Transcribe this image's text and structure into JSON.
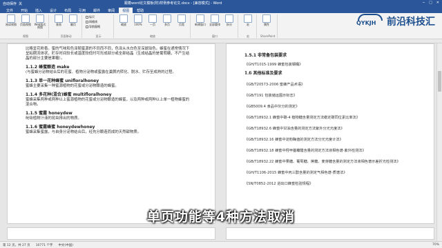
{
  "window": {
    "doc_title": "跟着word论文模板(附)样例参考论文.docx - [兼容模式] - Word",
    "quick_access": [
      "自动保存",
      "关"
    ]
  },
  "ribbon": {
    "tabs": [
      "文件",
      "开始",
      "插入",
      "设计",
      "布局",
      "引用",
      "邮件",
      "审阅",
      "视图",
      "帮助"
    ],
    "active_tab": "视图",
    "groups": [
      {
        "name": "视图",
        "buttons": [
          "阅读视图",
          "页面视图",
          "Web版式视图"
        ]
      },
      {
        "name": "页面移动",
        "buttons": [
          "垂直",
          "翻页"
        ]
      },
      {
        "name": "显示",
        "checks": [
          "标尺",
          "网格线",
          "导航窗格"
        ]
      },
      {
        "name": "缩放",
        "buttons": [
          "缩放",
          "100%",
          "一页",
          "多页",
          "页宽"
        ]
      },
      {
        "name": "窗口",
        "buttons": [
          "新建窗口",
          "全部重排",
          "拆分"
        ]
      },
      {
        "name": "宏",
        "buttons": [
          "宏"
        ]
      },
      {
        "name": "SharePoint",
        "buttons": [
          "属性"
        ]
      }
    ]
  },
  "logo": {
    "mark": "QYKJH",
    "name": "前沿科技汇"
  },
  "left_page": {
    "items": [
      {
        "type": "line",
        "text": "比略呈花粉香。蜜的气味和色泽随蜜源的不同而不同，色泽从水白色至深琥珀色。蜂蜜在通常情况下"
      },
      {
        "type": "line",
        "text": "呈粘稠流体状，贮存时间较长或温度较低时可形成部分或全部结晶（生成结晶的是葡萄糖，不产生结"
      },
      {
        "type": "line",
        "text": "晶的部分主要是果糖）。"
      },
      {
        "type": "hd",
        "text": "1.1.2 蜂蜜酿造 make"
      },
      {
        "type": "line",
        "text": "(与蜜蜂分泌物结合后的花蜜、植物分泌物或蜜露在巢脾内转化、脱水、贮存至成熟的过程。"
      },
      {
        "type": "hd",
        "text": "1.1.3 单一花种蜂蜜 unifloralhoney"
      },
      {
        "type": "line",
        "text": "蜜蜂主要采集一种蜜源植物的花蜜或分泌物酿造的蜂蜜。"
      },
      {
        "type": "hd",
        "text": "1.1.4 多花种(混合)蜂蜜 multifloralhoney"
      },
      {
        "type": "line",
        "text": "蜜蜂采集两种或两种以上蜜源植物的花蜜或分泌物酿造的蜂蜜，以及两种或两种以上单一植物蜂蜜的"
      },
      {
        "type": "line",
        "text": "混合物。"
      },
      {
        "type": "hd",
        "text": "1.1.5 蜜露 honeydew"
      },
      {
        "type": "line",
        "text": "吮吸植物汁液的昆虫排出的物质。"
      },
      {
        "type": "hd",
        "text": "1.1.6 蜜露蜂蜜 honeydewhoney"
      },
      {
        "type": "line",
        "text": "蜜蜂采集蜜露，与自身分泌物结合后，经充分酿造而成的天然甜物质。"
      }
    ]
  },
  "right_page": {
    "heading1": "1.5.1 非常备包装要求",
    "first_std": "《GH/T1015-1999 蜂蜜包装钢桶》",
    "heading2": "1.6 其他标准及要求",
    "standards": [
      "《GB/T20573-2006 蜜蜂产品术语》",
      "《GB/T191 包装储运图示标志》",
      "《GB5009.4 食品中灰分的测定》",
      "《GB/T18932.1 蜂蜜中碳-4 植物糖含量测定方法稳定碳同位素比率法》",
      "《GB/T18932.6 蜂蜜中甘油含量的测定方法紫外分光光度法》",
      "《GB/T18932.16 蜂蜜中淀粉酶值的测定方法分光光度计法》",
      "《GB/T18932.18 蜂蜜中羟甲基糠醛含量的测定方法液相色谱-紫外检测法》",
      "《GB/T18932.22 蜂蜜中果糖、葡萄糖、蔗糖、麦芽糖含量的测定方法液相色谱示差折光检测法》",
      "《GH/T1106-2015 蜂蜜中丙三醇含量的测定气相色谱-质谱法》",
      "《SN/T0852-2012 进出口蜂蜜检验规程》"
    ]
  },
  "status": {
    "page": "第 12 页，共 27 页",
    "words": "10771 个字",
    "lang": "中文(中国)",
    "zoom": "70%"
  },
  "subtitle": "单页功能等4种方法取消"
}
